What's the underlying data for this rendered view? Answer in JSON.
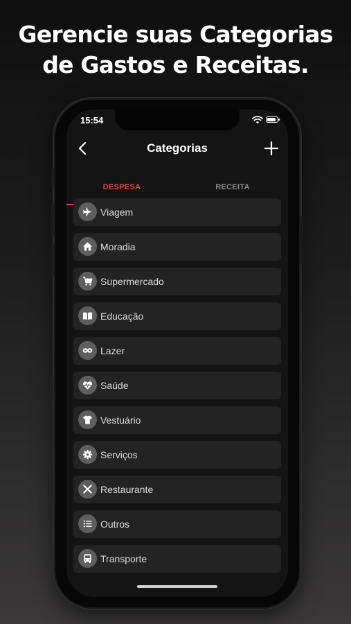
{
  "headline": {
    "line1": "Gerencie suas Categorias",
    "line2": "de Gastos e Receitas."
  },
  "status_bar": {
    "time": "15:54"
  },
  "navbar": {
    "title": "Categorias",
    "back_icon": "chevron-left-icon",
    "add_icon": "plus-icon"
  },
  "tabs": [
    {
      "label": "DESPESA",
      "active": true
    },
    {
      "label": "RECEITA",
      "active": false
    }
  ],
  "colors": {
    "accent": "#e0493b",
    "item_bg": "#232323",
    "icon_bg": "#5e5e5e",
    "screen_bg": "#141414"
  },
  "categories": [
    {
      "label": "Viagem",
      "icon": "airplane-icon"
    },
    {
      "label": "Moradia",
      "icon": "house-icon"
    },
    {
      "label": "Supermercado",
      "icon": "cart-icon"
    },
    {
      "label": "Educação",
      "icon": "book-icon"
    },
    {
      "label": "Lazer",
      "icon": "mask-icon"
    },
    {
      "label": "Saúde",
      "icon": "heart-pulse-icon"
    },
    {
      "label": "Vestuário",
      "icon": "shirt-icon"
    },
    {
      "label": "Serviços",
      "icon": "gear-icon"
    },
    {
      "label": "Restaurante",
      "icon": "utensils-icon"
    },
    {
      "label": "Outros",
      "icon": "list-icon"
    },
    {
      "label": "Transporte",
      "icon": "bus-icon"
    }
  ]
}
